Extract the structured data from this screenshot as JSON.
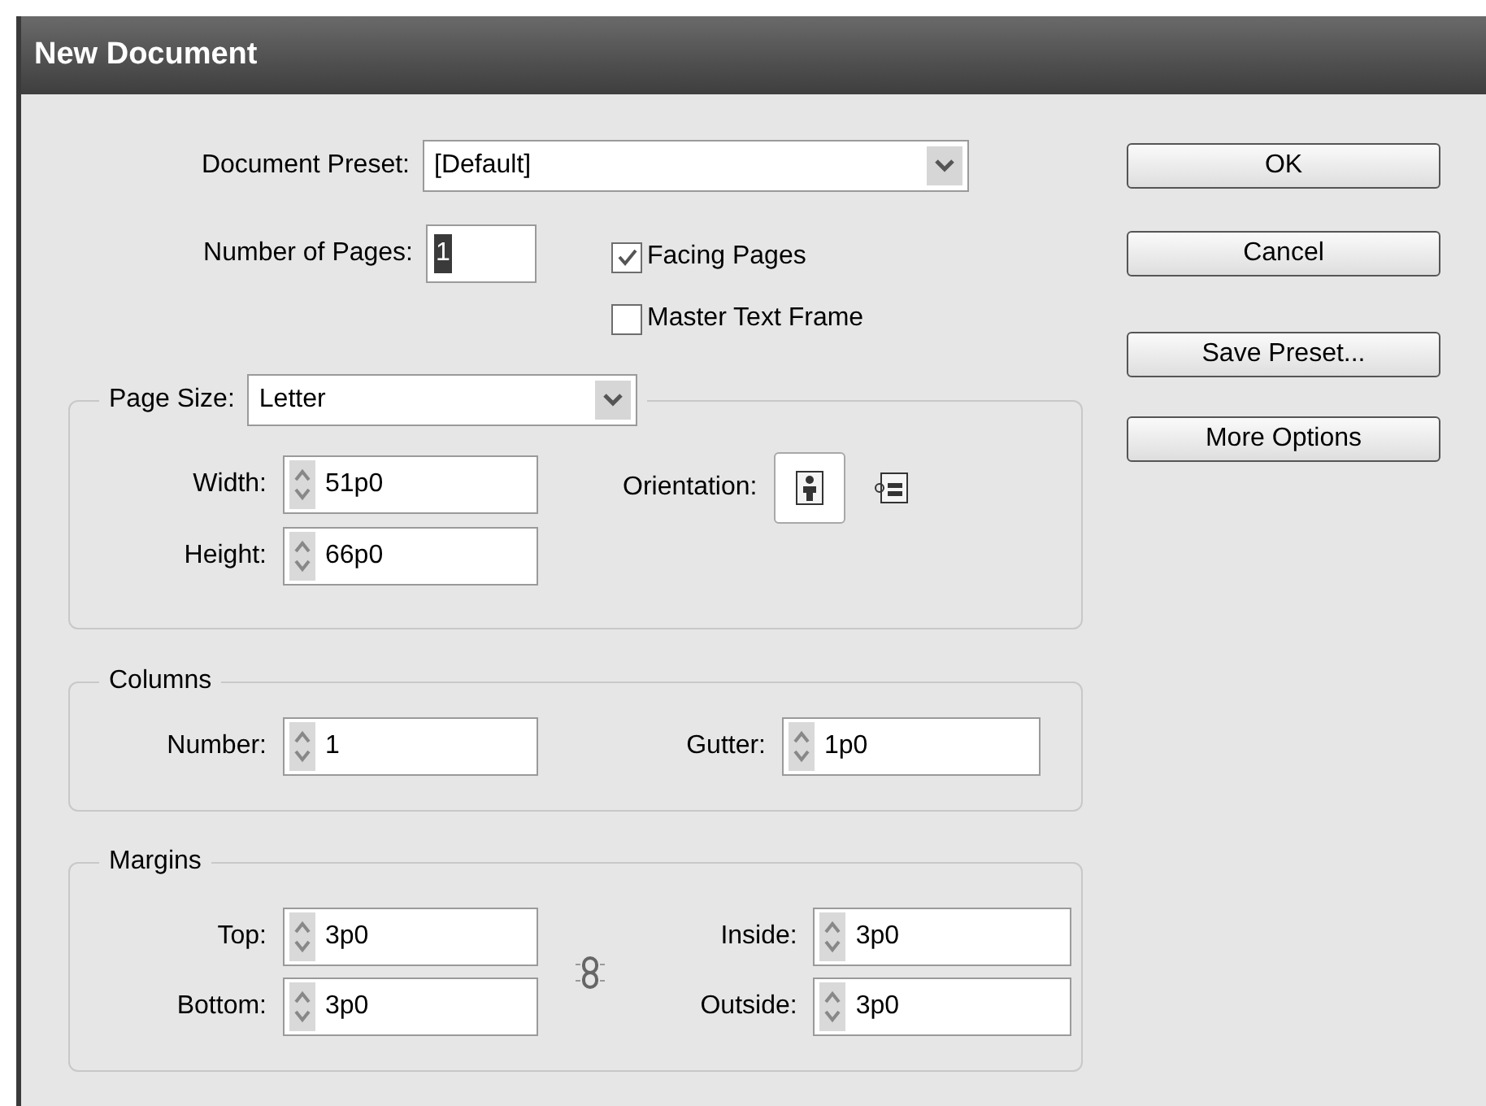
{
  "window": {
    "title": "New Document"
  },
  "document_preset": {
    "label": "Document Preset:",
    "value": "[Default]"
  },
  "number_of_pages": {
    "label": "Number of Pages:",
    "value": "1"
  },
  "checkboxes": [
    {
      "label": "Facing Pages",
      "checked": true
    },
    {
      "label": "Master Text Frame",
      "checked": false
    }
  ],
  "page_size": {
    "label": "Page Size:",
    "value": "Letter",
    "fields": [
      {
        "label": "Width:",
        "value": "51p0"
      },
      {
        "label": "Height:",
        "value": "66p0"
      }
    ],
    "orientation": {
      "label": "Orientation:",
      "options": [
        {
          "kind": "portrait",
          "selected": true
        },
        {
          "kind": "landscape",
          "selected": false
        }
      ]
    }
  },
  "columns": {
    "title": "Columns",
    "fields": [
      {
        "label": "Number:",
        "value": "1"
      },
      {
        "label": "Gutter:",
        "value": "1p0"
      }
    ]
  },
  "margins": {
    "title": "Margins",
    "fields": [
      {
        "label": "Top:",
        "value": "3p0"
      },
      {
        "label": "Inside:",
        "value": "3p0"
      },
      {
        "label": "Bottom:",
        "value": "3p0"
      },
      {
        "label": "Outside:",
        "value": "3p0"
      }
    ]
  },
  "buttons": [
    {
      "label": "OK"
    },
    {
      "label": "Cancel"
    },
    {
      "label": "Save Preset..."
    },
    {
      "label": "More Options"
    }
  ]
}
